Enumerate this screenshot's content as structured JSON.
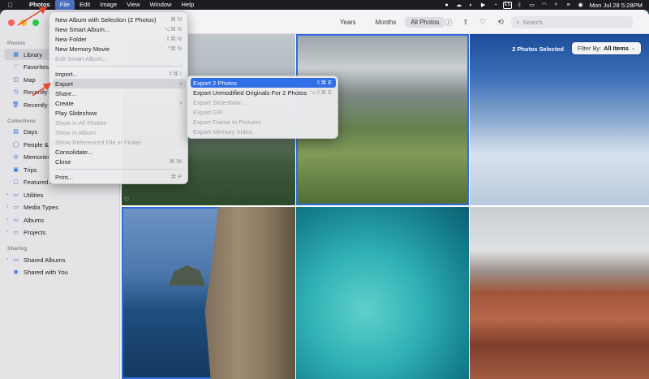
{
  "menubar": {
    "app": "Photos",
    "menus": [
      "File",
      "Edit",
      "Image",
      "View",
      "Window",
      "Help"
    ],
    "input_source": "ES",
    "clock": "Mon Jul 28  5:28PM"
  },
  "sidebar": {
    "section_photos": "Photos",
    "library": "Library",
    "favorites": "Favorites",
    "map": "Map",
    "recently_saved": "Recently Saved",
    "recently_deleted": "Recently Deleted",
    "section_collections": "Collections",
    "days": "Days",
    "people": "People & Pets",
    "memories": "Memories",
    "trips": "Trips",
    "featured": "Featured Photos",
    "utilities": "Utilities",
    "media_types": "Media Types",
    "albums": "Albums",
    "projects": "Projects",
    "section_sharing": "Sharing",
    "shared_albums": "Shared Albums",
    "shared_with_you": "Shared with You"
  },
  "toolbar": {
    "years": "Years",
    "months": "Months",
    "all_photos": "All Photos",
    "search_placeholder": "Search"
  },
  "grid": {
    "selected_count": "2 Photos Selected",
    "filter_label": "Filter By:",
    "filter_value": "All Items"
  },
  "file_menu": {
    "items": [
      {
        "label": "New Album with Selection (2 Photos)",
        "shortcut": "⌘ N"
      },
      {
        "label": "New Smart Album...",
        "shortcut": "⌥⌘ N"
      },
      {
        "label": "New Folder",
        "shortcut": "⇧⌘ N"
      },
      {
        "label": "New Memory Movie",
        "shortcut": "^⌘ N"
      },
      {
        "label": "Edit Smart Album...",
        "shortcut": ""
      },
      {
        "label": "Import...",
        "shortcut": "⇧⌘ I"
      },
      {
        "label": "Export",
        "shortcut": ""
      },
      {
        "label": "Share...",
        "shortcut": ""
      },
      {
        "label": "Create",
        "shortcut": ""
      },
      {
        "label": "Play Slideshow",
        "shortcut": ""
      },
      {
        "label": "Show in All Photos",
        "shortcut": ""
      },
      {
        "label": "Show in Album",
        "shortcut": ""
      },
      {
        "label": "Show Referenced File in Finder",
        "shortcut": ""
      },
      {
        "label": "Consolidate...",
        "shortcut": ""
      },
      {
        "label": "Close",
        "shortcut": "⌘ W"
      },
      {
        "label": "Print...",
        "shortcut": "⌘ P"
      }
    ]
  },
  "export_menu": {
    "items": [
      {
        "label": "Export 2 Photos",
        "shortcut": "⇧⌘ E"
      },
      {
        "label": "Export Unmodified Originals For 2 Photos",
        "shortcut": "⌥⇧⌘ E"
      },
      {
        "label": "Export Slideshow...",
        "shortcut": ""
      },
      {
        "label": "Export GIF",
        "shortcut": ""
      },
      {
        "label": "Export Frame to Pictures",
        "shortcut": ""
      },
      {
        "label": "Export Memory Video",
        "shortcut": ""
      }
    ]
  },
  "colors": {
    "accent": "#2f6ee5",
    "annotation": "#e8452c"
  }
}
